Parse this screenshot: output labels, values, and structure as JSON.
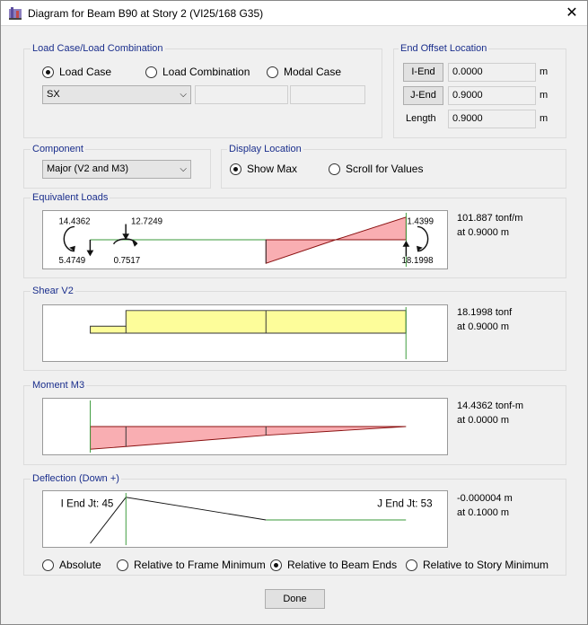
{
  "window": {
    "title": "Diagram for Beam B90 at Story 2 (VI25/168 G35)",
    "close": "✕"
  },
  "load_case": {
    "group_label": "Load Case/Load Combination",
    "options": [
      "Load Case",
      "Load Combination",
      "Modal Case"
    ],
    "selected": "Load Case",
    "combo_value": "SX"
  },
  "end_offset": {
    "group_label": "End Offset Location",
    "i_end_label": "I-End",
    "i_end_value": "0.0000",
    "j_end_label": "J-End",
    "j_end_value": "0.9000",
    "length_label": "Length",
    "length_value": "0.9000",
    "unit": "m"
  },
  "component": {
    "group_label": "Component",
    "value": "Major (V2 and M3)"
  },
  "display_location": {
    "group_label": "Display Location",
    "options": [
      "Show Max",
      "Scroll for Values"
    ],
    "selected": "Show Max"
  },
  "equivalent_loads": {
    "label": "Equivalent Loads",
    "annotations": [
      "14.4362",
      "12.7249",
      "1.4399",
      "5.4749",
      "0.7517",
      "18.1998"
    ],
    "readout_value": "101.887 tonf/m",
    "readout_at": "at 0.9000 m"
  },
  "shear": {
    "label": "Shear V2",
    "readout_value": "18.1998 tonf",
    "readout_at": "at 0.9000 m"
  },
  "moment": {
    "label": "Moment M3",
    "readout_value": "14.4362 tonf-m",
    "readout_at": "at 0.0000 m"
  },
  "deflection": {
    "label": "Deflection (Down +)",
    "i_end": "I End Jt: 45",
    "j_end": "J End Jt: 53",
    "readout_value": "-0.000004 m",
    "readout_at": "at 0.1000 m",
    "options": [
      "Absolute",
      "Relative to Frame Minimum",
      "Relative to Beam Ends",
      "Relative to Story Minimum"
    ],
    "selected": "Relative to Beam Ends"
  },
  "done_label": "Done",
  "colors": {
    "positive": "#f9aeb2",
    "shear_fill": "#fdfd9a",
    "guide_line": "#3a9a3a",
    "group_label": "#1a2e8c"
  },
  "icons": [
    "app-icon",
    "close-icon",
    "chevron-down-icon",
    "moment-arrow-icon",
    "force-arrow-icon"
  ]
}
